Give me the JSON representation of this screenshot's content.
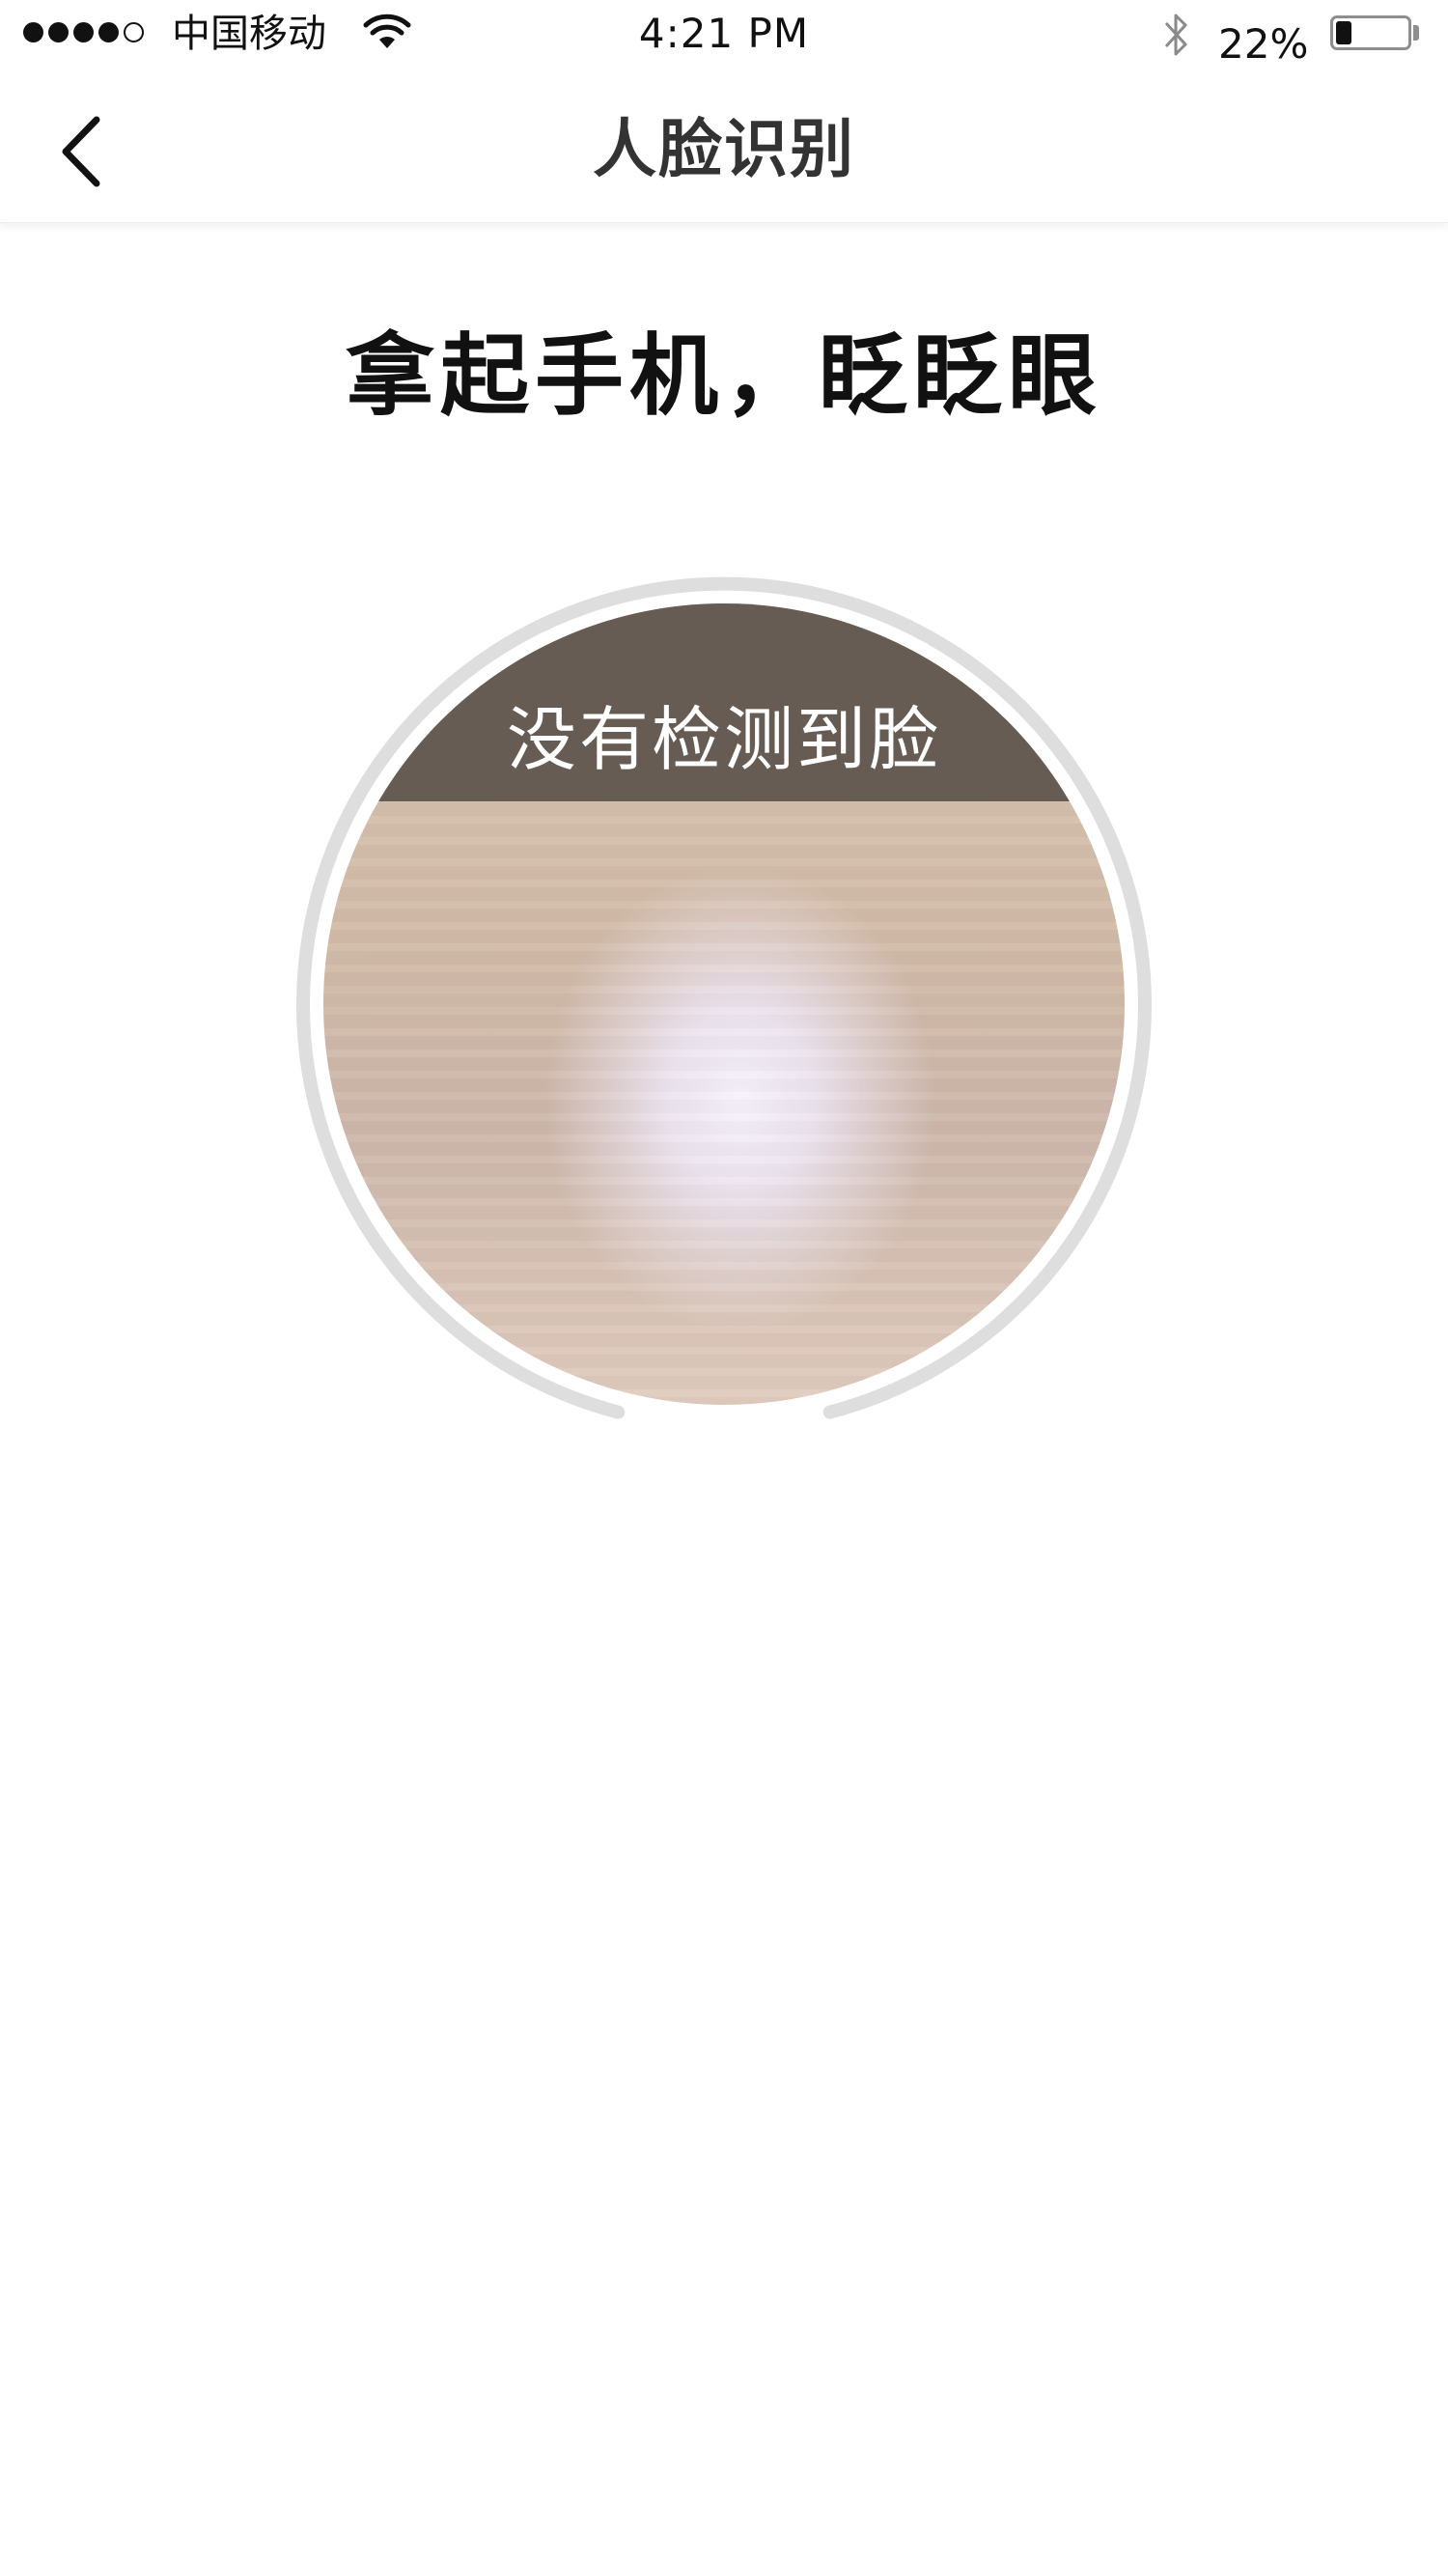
{
  "status_bar": {
    "carrier": "中国移动",
    "time": "4:21 PM",
    "battery_percent": "22%",
    "battery_level": 0.22,
    "signal_bars_filled": 4,
    "signal_bars_total": 5,
    "icons": [
      "signal-icon",
      "wifi-icon",
      "bluetooth-icon",
      "battery-icon"
    ]
  },
  "nav": {
    "title": "人脸识别",
    "back_icon": "chevron-left-icon"
  },
  "content": {
    "instruction": "拿起手机，眨眨眼",
    "camera_hint": "没有检测到脸"
  },
  "colors": {
    "ring": "#dedede",
    "hint_banner": "#675c53",
    "title_text": "#333333"
  }
}
